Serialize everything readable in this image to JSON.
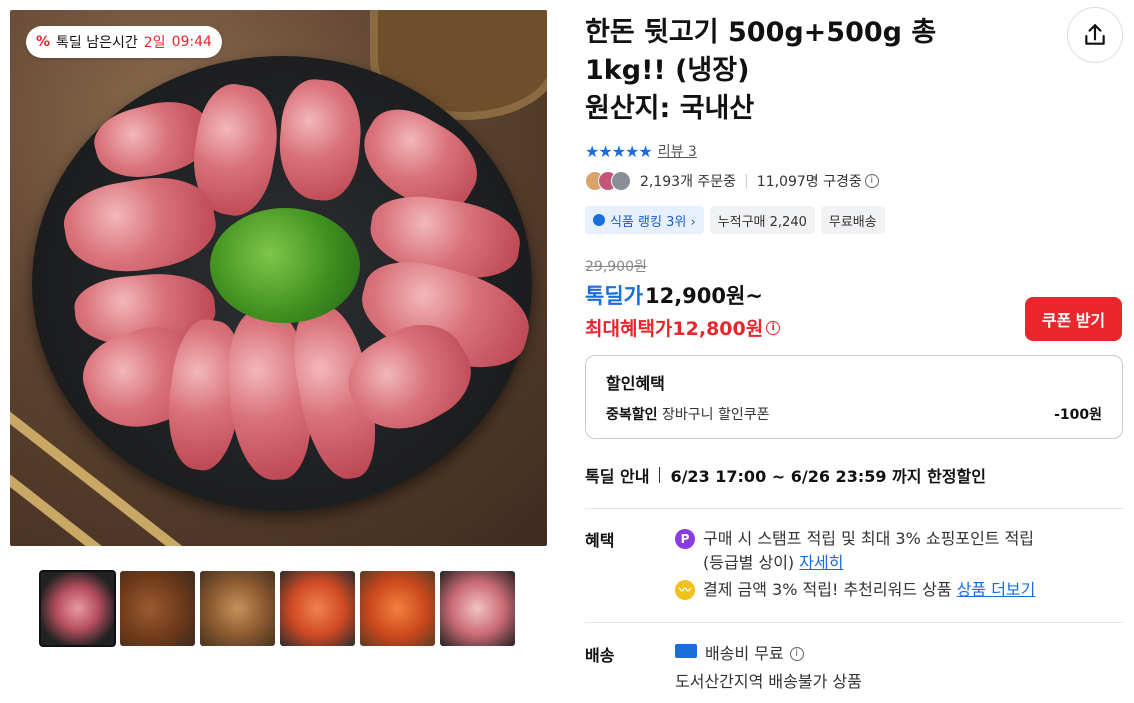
{
  "timer": {
    "icon": "percent-icon",
    "label": "톡딜 남은시간",
    "days": "2일",
    "time": "09:44"
  },
  "product": {
    "title_line1": "한돈 뒷고기 500g+500g 총",
    "title_line2": "1kg!! (냉장)",
    "title_line3": "원산지: 국내산",
    "stars": "★★★★★",
    "review": "리뷰 3",
    "orders": "2,193개 주문중",
    "viewers": "11,097명 구경중"
  },
  "chips": [
    {
      "label": "식품 랭킹 3위 ›"
    },
    {
      "label": "누적구매 2,240"
    },
    {
      "label": "무료배송"
    }
  ],
  "price": {
    "original": "29,900원",
    "deal_label": "톡딜가",
    "deal_value": "12,900원~",
    "max_label": "최대혜택가",
    "max_value": "12,800원",
    "coupon_button": "쿠폰 받기"
  },
  "discount": {
    "heading": "할인혜택",
    "name_bold": "중복할인",
    "name_rest": " 장바구니 할인쿠폰",
    "amount": "-100원"
  },
  "deal_info": {
    "key": "톡딜 안내",
    "value": "6/23 17:00 ~ 6/26 23:59 까지 한정할인"
  },
  "benefit": {
    "key": "혜택",
    "line1": "구매 시 스탬프 적립 및 최대 3% 쇼핑포인트 적립",
    "line1b": "(등급별 상이)",
    "line1_link": "자세히",
    "line2": "결제 금액 3% 적립! 추천리워드 상품",
    "line2_link": "상품 더보기",
    "icon1_letter": "P"
  },
  "shipping": {
    "key": "배송",
    "fee": "배송비 무료",
    "note": "도서산간지역 배송불가 상품"
  },
  "colors": {
    "accent": "#1a6ddc",
    "sale": "#e8262c"
  }
}
